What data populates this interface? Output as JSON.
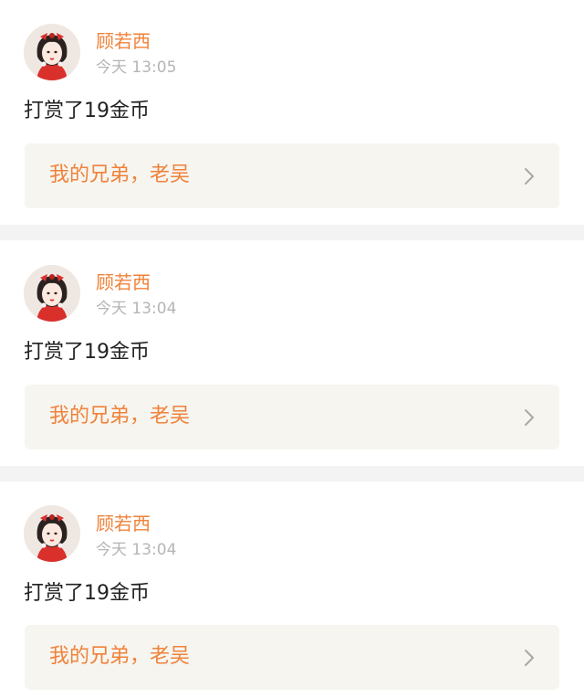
{
  "feed": {
    "items": [
      {
        "username": "顾若西",
        "timestamp": "今天 13:05",
        "message": "打赏了19金币",
        "reference_text": "我的兄弟，老吴"
      },
      {
        "username": "顾若西",
        "timestamp": "今天 13:04",
        "message": "打赏了19金币",
        "reference_text": "我的兄弟，老吴"
      },
      {
        "username": "顾若西",
        "timestamp": "今天 13:04",
        "message": "打赏了19金币",
        "reference_text": "我的兄弟，老吴"
      }
    ],
    "icons": {
      "avatar": "avatar-illustration-girl-red-bow",
      "chevron": "chevron-right-icon"
    },
    "colors": {
      "accent": "#f0823a",
      "timestamp": "#b5b5b5",
      "message": "#222222",
      "reference_bg": "#f6f5f0",
      "divider": "#f3f3f3"
    }
  }
}
